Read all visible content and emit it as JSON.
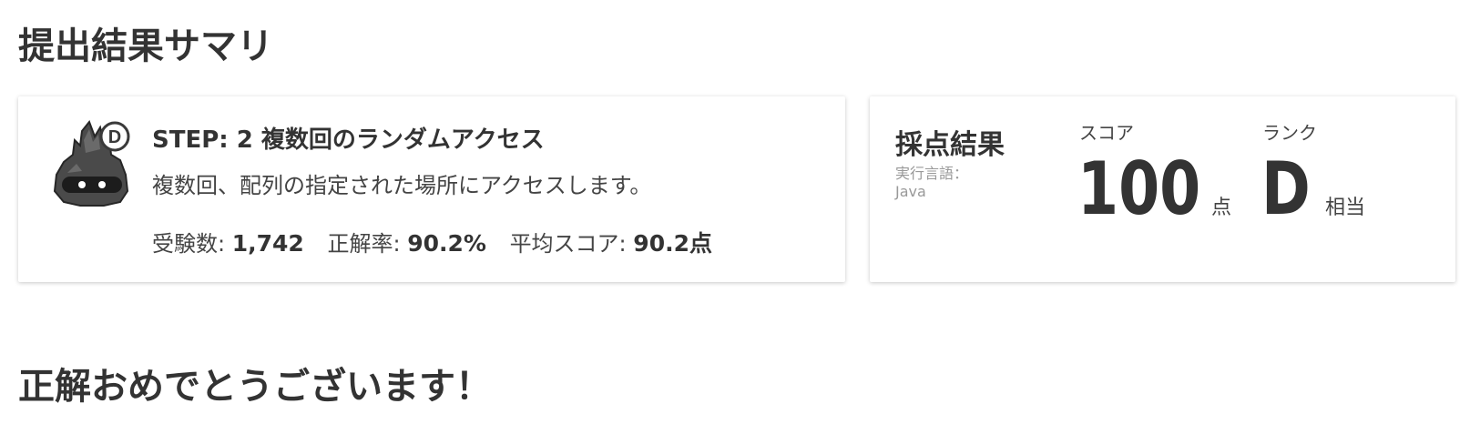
{
  "summary": {
    "heading": "提出結果サマリ"
  },
  "step": {
    "badge_letter": "D",
    "title": "STEP: 2 複数回のランダムアクセス",
    "description": "複数回、配列の指定された場所にアクセスします。",
    "stats": {
      "examinees_label": "受験数:",
      "examinees_value": "1,742",
      "accuracy_label": "正解率:",
      "accuracy_value": "90.2%",
      "avg_label": "平均スコア:",
      "avg_value": "90.2点"
    },
    "icon": "monster-icon"
  },
  "result": {
    "title": "採点結果",
    "language_label": "実行言語：",
    "language_value": "Java",
    "score_label": "スコア",
    "score_value": "100",
    "score_unit": "点",
    "rank_label": "ランク",
    "rank_value": "D",
    "rank_unit": "相当"
  },
  "congrats": {
    "heading": "正解おめでとうございます！"
  },
  "colors": {
    "text": "#333333",
    "muted": "#999999",
    "card_bg": "#ffffff"
  }
}
